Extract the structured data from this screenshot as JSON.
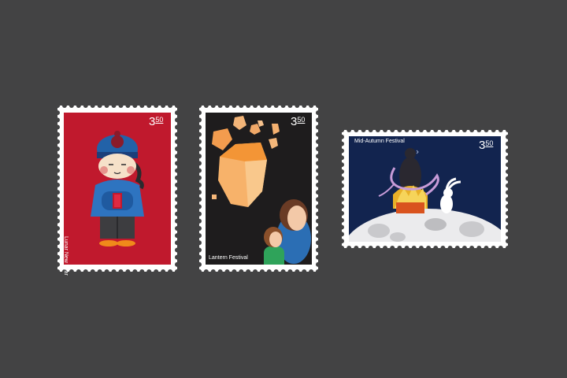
{
  "stamps": [
    {
      "name": "Lunar New Year",
      "price_main": "3",
      "price_cents": "50",
      "bg": "#c0192d"
    },
    {
      "name": "Lantern Festival",
      "price_main": "3",
      "price_cents": "50",
      "bg": "#1e1c1d"
    },
    {
      "name": "Mid-Autumn Festival",
      "price_main": "3",
      "price_cents": "50",
      "bg": "#12244f"
    }
  ]
}
